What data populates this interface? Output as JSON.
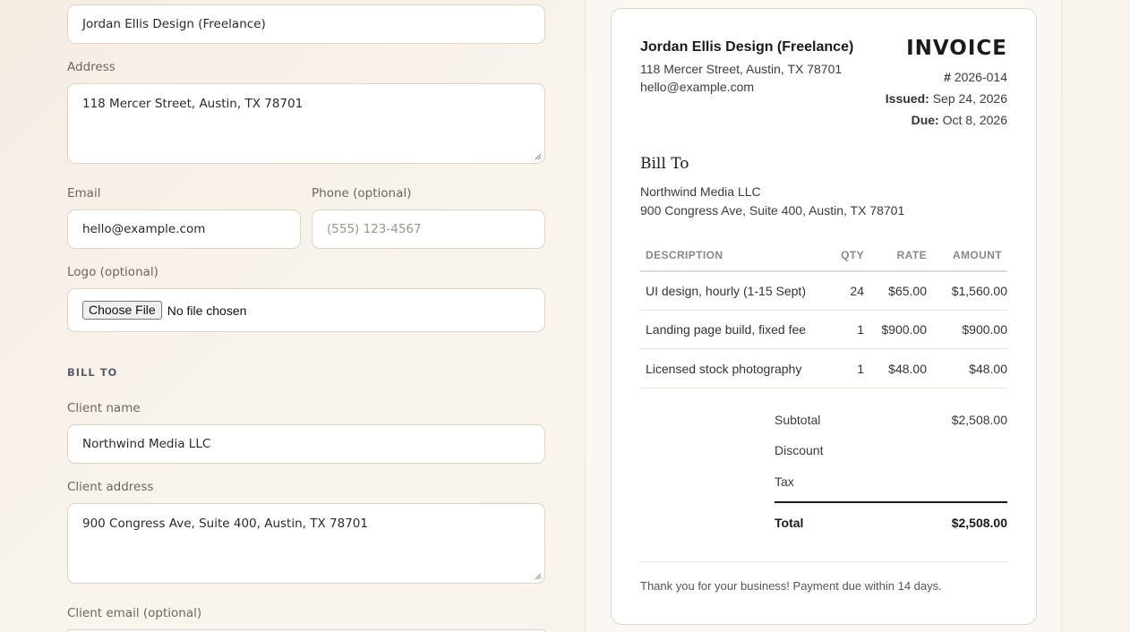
{
  "form": {
    "business_name_value": "Jordan Ellis Design (Freelance)",
    "address_label": "Address",
    "address_value": "118 Mercer Street, Austin, TX 78701",
    "email_label": "Email",
    "email_value": "hello@example.com",
    "phone_label": "Phone (optional)",
    "phone_placeholder": "(555) 123-4567",
    "logo_label": "Logo (optional)",
    "logo_button": "Choose File",
    "logo_status": "No file chosen",
    "bill_to_heading": "BILL TO",
    "client_name_label": "Client name",
    "client_name_value": "Northwind Media LLC",
    "client_address_label": "Client address",
    "client_address_value": "900 Congress Ave, Suite 400, Austin, TX 78701",
    "client_email_label": "Client email (optional)"
  },
  "invoice": {
    "seller_name": "Jordan Ellis Design (Freelance)",
    "seller_address": "118 Mercer Street, Austin, TX 78701",
    "seller_email": "hello@example.com",
    "title": "INVOICE",
    "number_prefix": "#",
    "number": "2026-014",
    "issued_label": "Issued:",
    "issued_date": "Sep 24, 2026",
    "due_label": "Due:",
    "due_date": "Oct 8, 2026",
    "bill_to_title": "Bill To",
    "client_name": "Northwind Media LLC",
    "client_address": "900 Congress Ave, Suite 400, Austin, TX 78701",
    "columns": {
      "description": "DESCRIPTION",
      "qty": "QTY",
      "rate": "RATE",
      "amount": "AMOUNT"
    },
    "items": [
      {
        "description": "UI design, hourly (1-15 Sept)",
        "qty": "24",
        "rate": "$65.00",
        "amount": "$1,560.00"
      },
      {
        "description": "Landing page build, fixed fee",
        "qty": "1",
        "rate": "$900.00",
        "amount": "$900.00"
      },
      {
        "description": "Licensed stock photography",
        "qty": "1",
        "rate": "$48.00",
        "amount": "$48.00"
      }
    ],
    "subtotal_label": "Subtotal",
    "subtotal_value": "$2,508.00",
    "discount_label": "Discount",
    "tax_label": "Tax",
    "total_label": "Total",
    "total_value": "$2,508.00",
    "footer_note": "Thank you for your business! Payment due within 14 days."
  }
}
